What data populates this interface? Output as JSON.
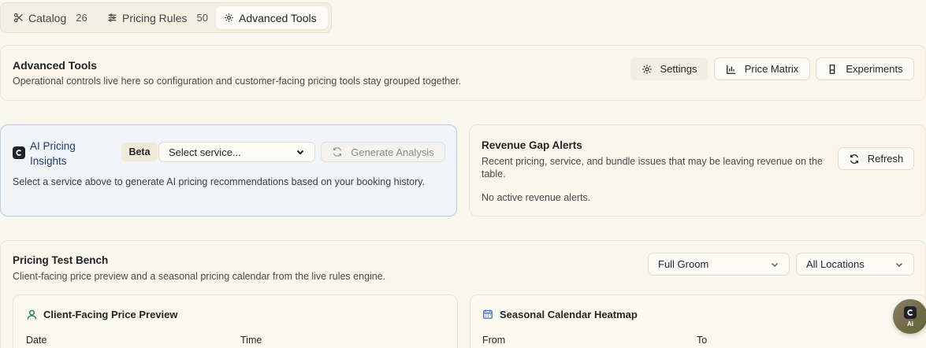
{
  "tabs": [
    {
      "label": "Catalog",
      "count": "26",
      "icon": "scissors-icon"
    },
    {
      "label": "Pricing Rules",
      "count": "50",
      "icon": "sliders-icon"
    },
    {
      "label": "Advanced Tools",
      "count": "",
      "icon": "gear-icon"
    }
  ],
  "advanced": {
    "title": "Advanced Tools",
    "subtitle": "Operational controls live here so configuration and customer-facing pricing tools stay grouped together.",
    "buttons": {
      "settings": "Settings",
      "price_matrix": "Price Matrix",
      "experiments": "Experiments"
    }
  },
  "ai": {
    "title_line1": "AI Pricing",
    "title_line2": "Insights",
    "badge": "Beta",
    "select_value": "Select service...",
    "generate_label": "Generate Analysis",
    "hint": "Select a service above to generate AI pricing recommendations based on your booking history."
  },
  "revenue": {
    "title": "Revenue Gap Alerts",
    "subtitle": "Recent pricing, service, and bundle issues that may be leaving revenue on the table.",
    "refresh_label": "Refresh",
    "empty": "No active revenue alerts."
  },
  "bench": {
    "title": "Pricing Test Bench",
    "subtitle": "Client-facing price preview and a seasonal pricing calendar from the live rules engine.",
    "service_select": "Full Groom",
    "location_select": "All Locations",
    "preview": {
      "title": "Client-Facing Price Preview",
      "date_label": "Date",
      "time_label": "Time"
    },
    "heatmap": {
      "title": "Seasonal Calendar Heatmap",
      "from_label": "From",
      "to_label": "To"
    }
  },
  "fab": {
    "label": "AI"
  },
  "colors": {
    "accent_green": "#2f8a5b",
    "accent_blue": "#3b6fd6",
    "ai_border": "#b8cce6"
  }
}
